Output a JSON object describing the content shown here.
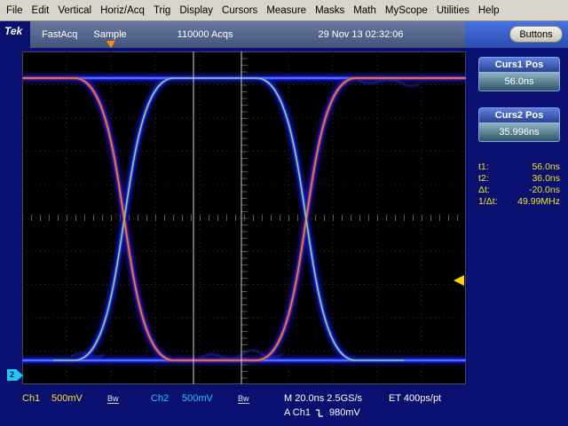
{
  "menu": {
    "items": [
      "File",
      "Edit",
      "Vertical",
      "Horiz/Acq",
      "Trig",
      "Display",
      "Cursors",
      "Measure",
      "Masks",
      "Math",
      "MyScope",
      "Utilities",
      "Help"
    ]
  },
  "status": {
    "logo": "Tek",
    "acq_mode": "FastAcq",
    "sample_mode": "Sample",
    "acq_count": "110000 Acqs",
    "datetime": "29 Nov 13 02:32:06",
    "buttons_label": "Buttons"
  },
  "sidebar": {
    "curs1": {
      "title": "Curs1 Pos",
      "value": "56.0ns"
    },
    "curs2": {
      "title": "Curs2 Pos",
      "value": "35.996ns"
    },
    "readout": {
      "t1_label": "t1:",
      "t1": "56.0ns",
      "t2_label": "t2:",
      "t2": "36.0ns",
      "dt_label": "Δt:",
      "dt": "-20.0ns",
      "inv_label": "1/Δt:",
      "inv": "49.99MHz"
    }
  },
  "bottom": {
    "ch1_label": "Ch1",
    "ch1_scale": "500mV",
    "bw": "Bw",
    "ch2_label": "Ch2",
    "ch2_scale": "500mV",
    "timebase": "M 20.0ns 2.5GS/s",
    "et": "ET 400ps/pt",
    "trig_source": "A Ch1",
    "trig_level": "980mV"
  },
  "plot": {
    "ch2_marker": "2"
  },
  "colors": {
    "bg_navy": "#0a1070",
    "trace_blue": "#2126e6",
    "trace_blue_core": "#4f6dff",
    "trace_cyan": "#45c8ff",
    "trace_orange": "#ff7a18",
    "trace_green": "#9adb4f",
    "readout_yellow": "#f5e12a",
    "ch1_yellow": "#f5e12a",
    "ch2_cyan": "#22c8f0",
    "trigger_yellow": "#ffd400"
  }
}
